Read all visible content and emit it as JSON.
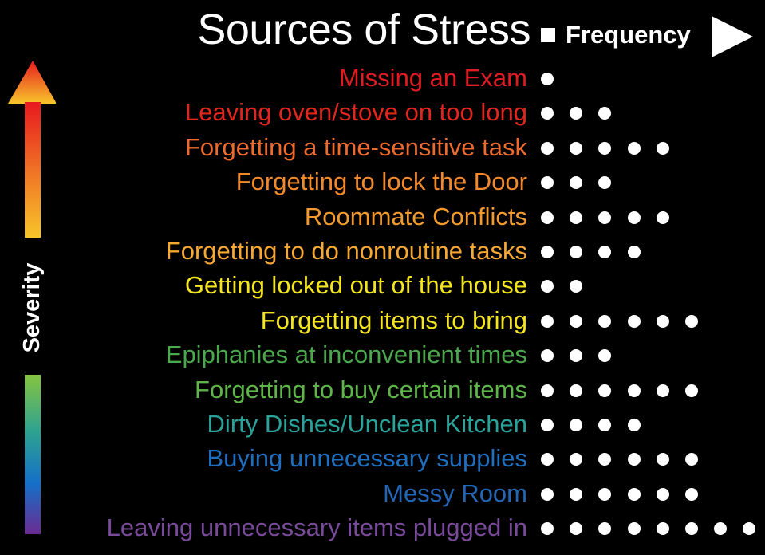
{
  "chart_data": {
    "type": "scatter",
    "title": "Sources of Stress",
    "x_axis_label": "Frequency",
    "y_axis_label": "Severity",
    "colors": {
      "background": "#000000",
      "dot": "#ffffff",
      "severity_gradient": [
        "#e8191f",
        "#f07a26",
        "#f5ba2a",
        "#7cbe3d",
        "#2e9e8f",
        "#1677c7",
        "#6a2c91"
      ]
    },
    "rows": [
      {
        "label": "Missing an Exam",
        "frequency": 1,
        "color": "#e01b22"
      },
      {
        "label": "Leaving oven/stove on too long",
        "frequency": 3,
        "color": "#e2261e"
      },
      {
        "label": "Forgetting a time-sensitive task",
        "frequency": 5,
        "color": "#ee6a2d"
      },
      {
        "label": "Forgetting to lock the Door",
        "frequency": 3,
        "color": "#f28a2c"
      },
      {
        "label": "Roommate Conflicts",
        "frequency": 5,
        "color": "#f39a2c"
      },
      {
        "label": "Forgetting to do nonroutine tasks",
        "frequency": 4,
        "color": "#f6a832"
      },
      {
        "label": "Getting locked out of the house",
        "frequency": 2,
        "color": "#f4e51f"
      },
      {
        "label": "Forgetting items to bring",
        "frequency": 6,
        "color": "#f4e51f"
      },
      {
        "label": "Epiphanies at inconvenient times",
        "frequency": 3,
        "color": "#4ba84c"
      },
      {
        "label": "Forgetting to buy certain items",
        "frequency": 6,
        "color": "#5fb54a"
      },
      {
        "label": "Dirty Dishes/Unclean Kitchen",
        "frequency": 4,
        "color": "#2aa39a"
      },
      {
        "label": "Buying unnecessary supplies",
        "frequency": 6,
        "color": "#1e6fc0"
      },
      {
        "label": "Messy Room",
        "frequency": 6,
        "color": "#2266b5"
      },
      {
        "label": "Leaving unnecessary items plugged in",
        "frequency": 8,
        "color": "#7a4a9a"
      }
    ]
  }
}
